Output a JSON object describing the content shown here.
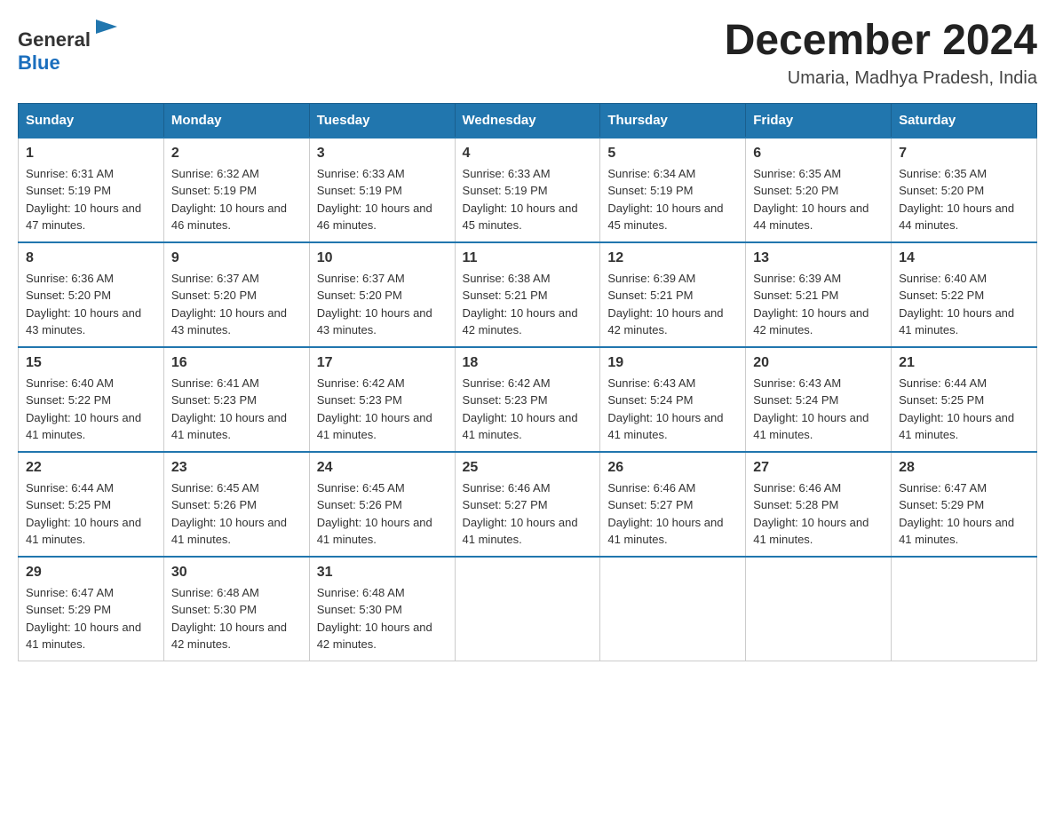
{
  "header": {
    "logo_text_general": "General",
    "logo_text_blue": "Blue",
    "month_title": "December 2024",
    "location": "Umaria, Madhya Pradesh, India"
  },
  "days_of_week": [
    "Sunday",
    "Monday",
    "Tuesday",
    "Wednesday",
    "Thursday",
    "Friday",
    "Saturday"
  ],
  "weeks": [
    [
      {
        "day": "1",
        "sunrise": "6:31 AM",
        "sunset": "5:19 PM",
        "daylight": "10 hours and 47 minutes."
      },
      {
        "day": "2",
        "sunrise": "6:32 AM",
        "sunset": "5:19 PM",
        "daylight": "10 hours and 46 minutes."
      },
      {
        "day": "3",
        "sunrise": "6:33 AM",
        "sunset": "5:19 PM",
        "daylight": "10 hours and 46 minutes."
      },
      {
        "day": "4",
        "sunrise": "6:33 AM",
        "sunset": "5:19 PM",
        "daylight": "10 hours and 45 minutes."
      },
      {
        "day": "5",
        "sunrise": "6:34 AM",
        "sunset": "5:19 PM",
        "daylight": "10 hours and 45 minutes."
      },
      {
        "day": "6",
        "sunrise": "6:35 AM",
        "sunset": "5:20 PM",
        "daylight": "10 hours and 44 minutes."
      },
      {
        "day": "7",
        "sunrise": "6:35 AM",
        "sunset": "5:20 PM",
        "daylight": "10 hours and 44 minutes."
      }
    ],
    [
      {
        "day": "8",
        "sunrise": "6:36 AM",
        "sunset": "5:20 PM",
        "daylight": "10 hours and 43 minutes."
      },
      {
        "day": "9",
        "sunrise": "6:37 AM",
        "sunset": "5:20 PM",
        "daylight": "10 hours and 43 minutes."
      },
      {
        "day": "10",
        "sunrise": "6:37 AM",
        "sunset": "5:20 PM",
        "daylight": "10 hours and 43 minutes."
      },
      {
        "day": "11",
        "sunrise": "6:38 AM",
        "sunset": "5:21 PM",
        "daylight": "10 hours and 42 minutes."
      },
      {
        "day": "12",
        "sunrise": "6:39 AM",
        "sunset": "5:21 PM",
        "daylight": "10 hours and 42 minutes."
      },
      {
        "day": "13",
        "sunrise": "6:39 AM",
        "sunset": "5:21 PM",
        "daylight": "10 hours and 42 minutes."
      },
      {
        "day": "14",
        "sunrise": "6:40 AM",
        "sunset": "5:22 PM",
        "daylight": "10 hours and 41 minutes."
      }
    ],
    [
      {
        "day": "15",
        "sunrise": "6:40 AM",
        "sunset": "5:22 PM",
        "daylight": "10 hours and 41 minutes."
      },
      {
        "day": "16",
        "sunrise": "6:41 AM",
        "sunset": "5:23 PM",
        "daylight": "10 hours and 41 minutes."
      },
      {
        "day": "17",
        "sunrise": "6:42 AM",
        "sunset": "5:23 PM",
        "daylight": "10 hours and 41 minutes."
      },
      {
        "day": "18",
        "sunrise": "6:42 AM",
        "sunset": "5:23 PM",
        "daylight": "10 hours and 41 minutes."
      },
      {
        "day": "19",
        "sunrise": "6:43 AM",
        "sunset": "5:24 PM",
        "daylight": "10 hours and 41 minutes."
      },
      {
        "day": "20",
        "sunrise": "6:43 AM",
        "sunset": "5:24 PM",
        "daylight": "10 hours and 41 minutes."
      },
      {
        "day": "21",
        "sunrise": "6:44 AM",
        "sunset": "5:25 PM",
        "daylight": "10 hours and 41 minutes."
      }
    ],
    [
      {
        "day": "22",
        "sunrise": "6:44 AM",
        "sunset": "5:25 PM",
        "daylight": "10 hours and 41 minutes."
      },
      {
        "day": "23",
        "sunrise": "6:45 AM",
        "sunset": "5:26 PM",
        "daylight": "10 hours and 41 minutes."
      },
      {
        "day": "24",
        "sunrise": "6:45 AM",
        "sunset": "5:26 PM",
        "daylight": "10 hours and 41 minutes."
      },
      {
        "day": "25",
        "sunrise": "6:46 AM",
        "sunset": "5:27 PM",
        "daylight": "10 hours and 41 minutes."
      },
      {
        "day": "26",
        "sunrise": "6:46 AM",
        "sunset": "5:27 PM",
        "daylight": "10 hours and 41 minutes."
      },
      {
        "day": "27",
        "sunrise": "6:46 AM",
        "sunset": "5:28 PM",
        "daylight": "10 hours and 41 minutes."
      },
      {
        "day": "28",
        "sunrise": "6:47 AM",
        "sunset": "5:29 PM",
        "daylight": "10 hours and 41 minutes."
      }
    ],
    [
      {
        "day": "29",
        "sunrise": "6:47 AM",
        "sunset": "5:29 PM",
        "daylight": "10 hours and 41 minutes."
      },
      {
        "day": "30",
        "sunrise": "6:48 AM",
        "sunset": "5:30 PM",
        "daylight": "10 hours and 42 minutes."
      },
      {
        "day": "31",
        "sunrise": "6:48 AM",
        "sunset": "5:30 PM",
        "daylight": "10 hours and 42 minutes."
      },
      null,
      null,
      null,
      null
    ]
  ]
}
